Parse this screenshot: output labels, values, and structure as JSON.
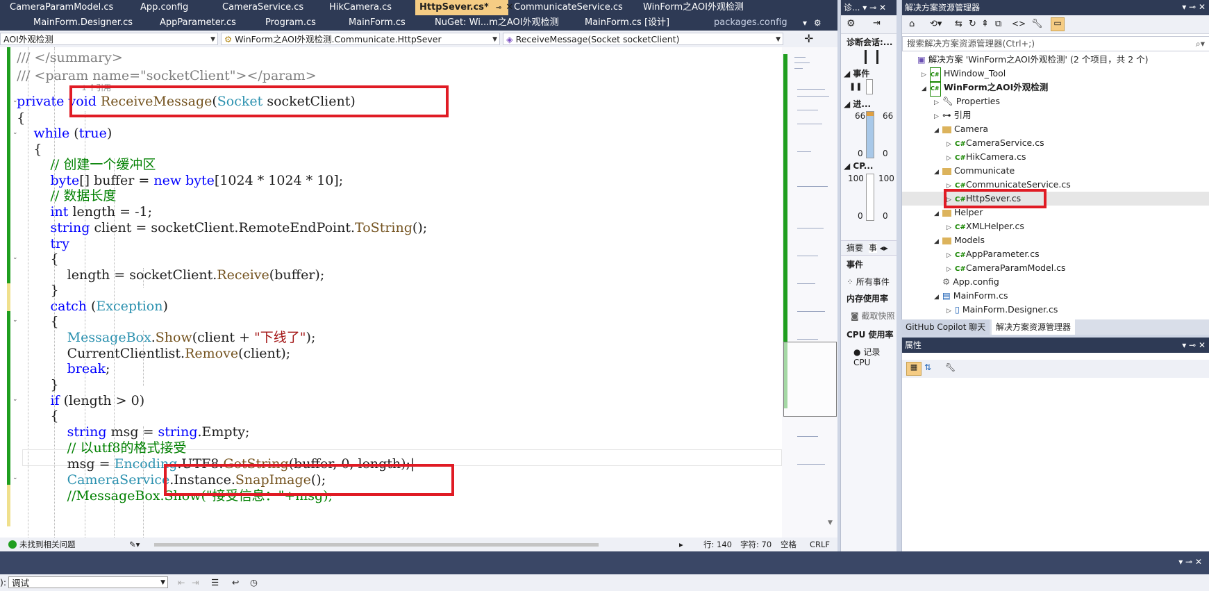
{
  "tabs_row1": [
    {
      "label": "CameraParamModel.cs"
    },
    {
      "label": "App.config"
    },
    {
      "label": "CameraService.cs"
    },
    {
      "label": "HikCamera.cs"
    },
    {
      "label": "HttpSever.cs*",
      "active": true
    },
    {
      "label": "CommunicateService.cs"
    },
    {
      "label": "WinForm之AOI外观检测"
    }
  ],
  "tabs_row2": [
    {
      "label": "MainForm.Designer.cs"
    },
    {
      "label": "AppParameter.cs"
    },
    {
      "label": "Program.cs"
    },
    {
      "label": "MainForm.cs"
    },
    {
      "label": "NuGet: Wi...m之AOI外观检测"
    },
    {
      "label": "MainForm.cs [设计]"
    },
    {
      "label": "packages.config"
    }
  ],
  "nav": {
    "project": "AOI外观检测",
    "class": "WinForm之AOI外观检测.Communicate.HttpSever",
    "member": "ReceiveMessage(Socket socketClient)"
  },
  "refs_label": "1 个引用",
  "editor_status": {
    "issues": "未找到相关问题",
    "line": "行: 140",
    "char": "字符: 70",
    "space": "空格",
    "eol": "CRLF"
  },
  "diag": {
    "title": "诊...",
    "session": "诊断会话:...",
    "events": "事件",
    "process": "进...",
    "proc_hi": "66",
    "proc_lo": "0",
    "cpu": "CP...",
    "cpu_hi": "100",
    "cpu_lo": "0",
    "tab_summary": "摘要",
    "tab_events": "事",
    "events_header": "事件",
    "all_events": "所有事件",
    "memory": "内存使用率",
    "snapshot": "截取快照",
    "cpu_usage": "CPU 使用率",
    "record_cpu": "记录 CPU"
  },
  "solution": {
    "title": "解决方案资源管理器",
    "search_placeholder": "搜索解决方案资源管理器(Ctrl+;)",
    "nodes": [
      {
        "label": "解决方案 'WinForm之AOI外观检测' (2 个项目，共 2 个)",
        "level": 0,
        "kind": "solution"
      },
      {
        "label": "HWindow_Tool",
        "level": 1,
        "kind": "project",
        "arrow": "right"
      },
      {
        "label": "WinForm之AOI外观检测",
        "level": 1,
        "kind": "project",
        "arrow": "down",
        "bold": true
      },
      {
        "label": "Properties",
        "level": 2,
        "kind": "wrench",
        "arrow": "right"
      },
      {
        "label": "引用",
        "level": 2,
        "kind": "ref",
        "arrow": "right"
      },
      {
        "label": "Camera",
        "level": 2,
        "kind": "folder",
        "arrow": "down"
      },
      {
        "label": "CameraService.cs",
        "level": 3,
        "kind": "cs",
        "arrow": "right"
      },
      {
        "label": "HikCamera.cs",
        "level": 3,
        "kind": "cs",
        "arrow": "right"
      },
      {
        "label": "Communicate",
        "level": 2,
        "kind": "folder",
        "arrow": "down"
      },
      {
        "label": "CommunicateService.cs",
        "level": 3,
        "kind": "cs",
        "arrow": "right"
      },
      {
        "label": "HttpSever.cs",
        "level": 3,
        "kind": "cs",
        "arrow": "right",
        "selected": true
      },
      {
        "label": "Helper",
        "level": 2,
        "kind": "folder",
        "arrow": "down"
      },
      {
        "label": "XMLHelper.cs",
        "level": 3,
        "kind": "cs",
        "arrow": "right"
      },
      {
        "label": "Models",
        "level": 2,
        "kind": "folder",
        "arrow": "down"
      },
      {
        "label": "AppParameter.cs",
        "level": 3,
        "kind": "cs",
        "arrow": "right"
      },
      {
        "label": "CameraParamModel.cs",
        "level": 3,
        "kind": "cs",
        "arrow": "right"
      },
      {
        "label": "App.config",
        "level": 2,
        "kind": "config"
      },
      {
        "label": "MainForm.cs",
        "level": 2,
        "kind": "form",
        "arrow": "down"
      },
      {
        "label": "MainForm.Designer.cs",
        "level": 3,
        "kind": "file",
        "arrow": "right"
      }
    ]
  },
  "bottom_tabs": {
    "copilot": "GitHub Copilot 聊天",
    "solution": "解决方案资源管理器"
  },
  "props_title": "属性",
  "output": {
    "prefix": "):",
    "value": "调试"
  },
  "code_lines": [
    "    /// </summary>",
    "    /// <param name=\"socketClient\"></param>",
    "    private void ReceiveMessage(Socket socketClient)",
    "    {",
    "        while (true)",
    "        {",
    "            // 创建一个缓冲区",
    "            byte[] buffer = new byte[1024 * 1024 * 10];",
    "            // 数据长度",
    "            int length = -1;",
    "            string client = socketClient.RemoteEndPoint.ToString();",
    "            try",
    "            {",
    "                length = socketClient.Receive(buffer);",
    "            }",
    "            catch (Exception)",
    "            {",
    "                MessageBox.Show(client + \"下线了\");",
    "                CurrentClientlist.Remove(client);",
    "                break;",
    "            }",
    "            if (length > 0)",
    "            {",
    "                string msg = string.Empty;",
    "                // 以utf8的格式接受",
    "                msg = Encoding.UTF8.GetString(buffer, 0, length);",
    "                CameraService.Instance.SnapImage();",
    "                //MessageBox.Show(\"接受信息：\"+msg);"
  ]
}
